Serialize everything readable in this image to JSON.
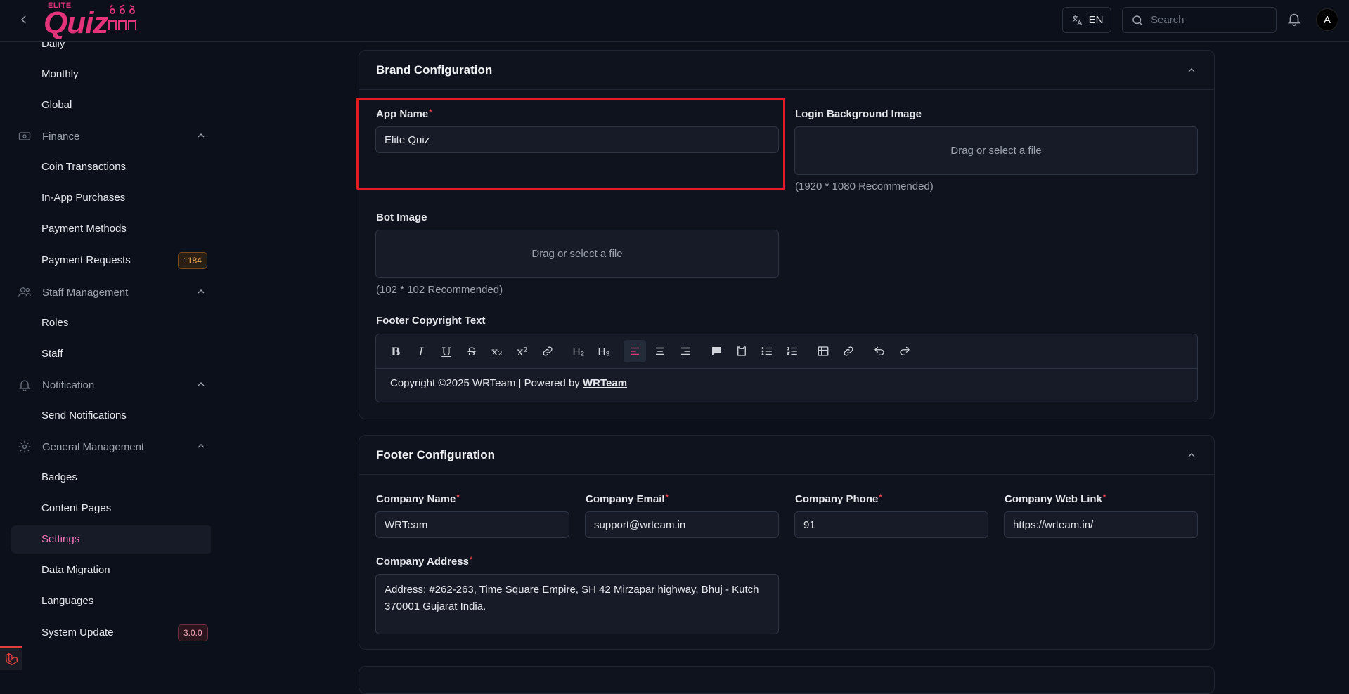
{
  "header": {
    "logo_top": "ELITE",
    "logo_main": "Quiz",
    "lang": "EN",
    "search_placeholder": "Search",
    "avatar_initial": "A"
  },
  "sidebar": {
    "daily": "Daily",
    "monthly": "Monthly",
    "global": "Global",
    "finance": "Finance",
    "coin_transactions": "Coin Transactions",
    "in_app_purchases": "In-App Purchases",
    "payment_methods": "Payment Methods",
    "payment_requests": "Payment Requests",
    "payment_requests_badge": "1184",
    "staff_management": "Staff Management",
    "roles": "Roles",
    "staff": "Staff",
    "notification": "Notification",
    "send_notifications": "Send Notifications",
    "general_management": "General Management",
    "badges": "Badges",
    "content_pages": "Content Pages",
    "settings": "Settings",
    "data_migration": "Data Migration",
    "languages": "Languages",
    "system_update": "System Update",
    "version_badge": "3.0.0"
  },
  "brand": {
    "title": "Brand Configuration",
    "app_name_label": "App Name",
    "app_name_value": "Elite Quiz",
    "login_bg_label": "Login Background Image",
    "dropzone_text": "Drag or select a file",
    "login_bg_hint": "(1920 * 1080 Recommended)",
    "bot_image_label": "Bot Image",
    "bot_image_hint": "(102 * 102 Recommended)",
    "footer_copyright_label": "Footer Copyright Text",
    "copyright_text": "Copyright ©2025 WRTeam | Powered by ",
    "copyright_link": "WRTeam"
  },
  "footer_config": {
    "title": "Footer Configuration",
    "company_name_label": "Company Name",
    "company_name_value": "WRTeam",
    "company_email_label": "Company Email",
    "company_email_value": "support@wrteam.in",
    "company_phone_label": "Company Phone",
    "company_phone_value": "91",
    "company_web_label": "Company Web Link",
    "company_web_value": "https://wrteam.in/",
    "company_address_label": "Company Address",
    "company_address_value": "Address: #262-263, Time Square Empire, SH 42 Mirzapar highway,  Bhuj - Kutch 370001 Gujarat India."
  },
  "toolbar": {
    "h2": "H₂",
    "h3": "H₃",
    "sub": "x₂",
    "sup": "x²"
  }
}
